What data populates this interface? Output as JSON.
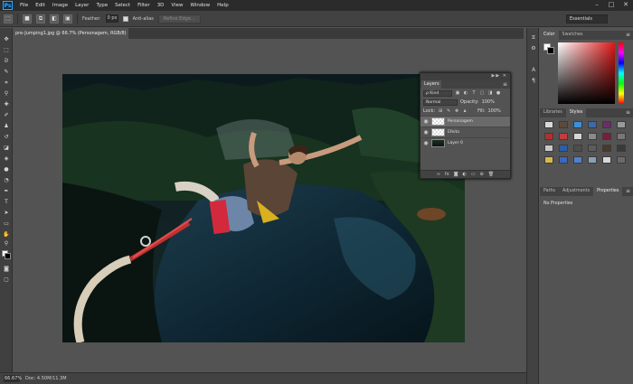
{
  "app": {
    "logo": "Ps",
    "menu": [
      "File",
      "Edit",
      "Image",
      "Layer",
      "Type",
      "Select",
      "Filter",
      "3D",
      "View",
      "Window",
      "Help"
    ],
    "window_controls": [
      "–",
      "□",
      "✕"
    ]
  },
  "options_bar": {
    "feather_label": "Feather:",
    "feather_value": "0 px",
    "antialias_label": "Anti-alias",
    "refine_edge_label": "Refine Edge...",
    "workspace": "Essentials"
  },
  "document": {
    "tab_title": "pre-Jumping1.jpg @ 66.7% (Personagem, RGB/8) *",
    "close": "×"
  },
  "status_bar": {
    "zoom": "66.67%",
    "doc_info": "Doc: 4.50M/11.3M"
  },
  "layers_panel": {
    "tab": "Layers",
    "kind_label": "ρ Kind",
    "blend_mode": "Normal",
    "opacity_label": "Opacity:",
    "opacity_value": "100%",
    "lock_label": "Lock:",
    "fill_label": "Fill:",
    "fill_value": "100%",
    "layers": [
      {
        "name": "Personagem",
        "active": true
      },
      {
        "name": "Efeito",
        "active": false
      },
      {
        "name": "Layer 0",
        "active": false
      }
    ],
    "footer_icons": [
      "link-icon",
      "fx-icon",
      "mask-icon",
      "adjustment-icon",
      "folder-icon",
      "new-layer-icon",
      "trash-icon"
    ]
  },
  "right_panels": {
    "color_tabs": [
      "Color",
      "Swatches"
    ],
    "styles_tabs": [
      "Libraries",
      "Styles"
    ],
    "props_tabs": [
      "Paths",
      "Adjustments",
      "Properties"
    ],
    "props_title": "No Properties",
    "style_swatches": [
      "#d9d9d9",
      "#5c4a3a",
      "#3c8fd8",
      "#3b6aa8",
      "#6a2d6a",
      "#9a9a9a",
      "#b03030",
      "#c23d3d",
      "#d6d6d6",
      "#8a8a8a",
      "#7a1f3a",
      "#777777",
      "#c8c8c8",
      "#2b5fa8",
      "#4d4d4d",
      "#5d5d5d",
      "#4a3a2a",
      "#3a3a3a",
      "#d8b84a",
      "#3a68c0",
      "#4f7fd0",
      "#8aa0b8",
      "#d8d8d8",
      "#6a6a6a"
    ]
  },
  "colors": {
    "accent": "#31a8ff",
    "panel_bg": "#535353",
    "dark_bar": "#2b2b2b"
  }
}
